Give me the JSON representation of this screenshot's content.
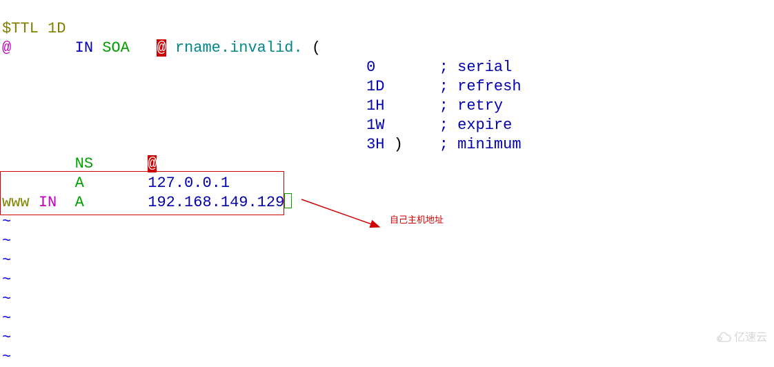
{
  "zonefile": {
    "ttl_directive": "$TTL 1D",
    "origin_at1": "@",
    "class1": "IN",
    "soa_keyword": "SOA",
    "soa_at": "@",
    "rname": "rname.invalid.",
    "open_paren": "(",
    "serial_val": "0",
    "serial_lbl": "; serial",
    "refresh_val": "1D",
    "refresh_lbl": "; refresh",
    "retry_val": "1H",
    "retry_lbl": "; retry",
    "expire_val": "1W",
    "expire_lbl": "; expire",
    "minimum_val": "3H",
    "close_paren": ")",
    "minimum_lbl": "; minimum",
    "ns_keyword": "NS",
    "ns_at": "@",
    "a1_keyword": "A",
    "a1_addr": "127.0.0.1",
    "www_name": "www",
    "www_class": "IN",
    "www_keyword": "A",
    "www_addr": "192.168.149.129"
  },
  "tildes": [
    "~",
    "~",
    "~",
    "~",
    "~",
    "~",
    "~",
    "~"
  ],
  "annotation": {
    "label": "自己主机地址",
    "arrow_color": "#d00000",
    "box_color": "#d00000"
  },
  "watermark": {
    "text": "亿速云"
  }
}
